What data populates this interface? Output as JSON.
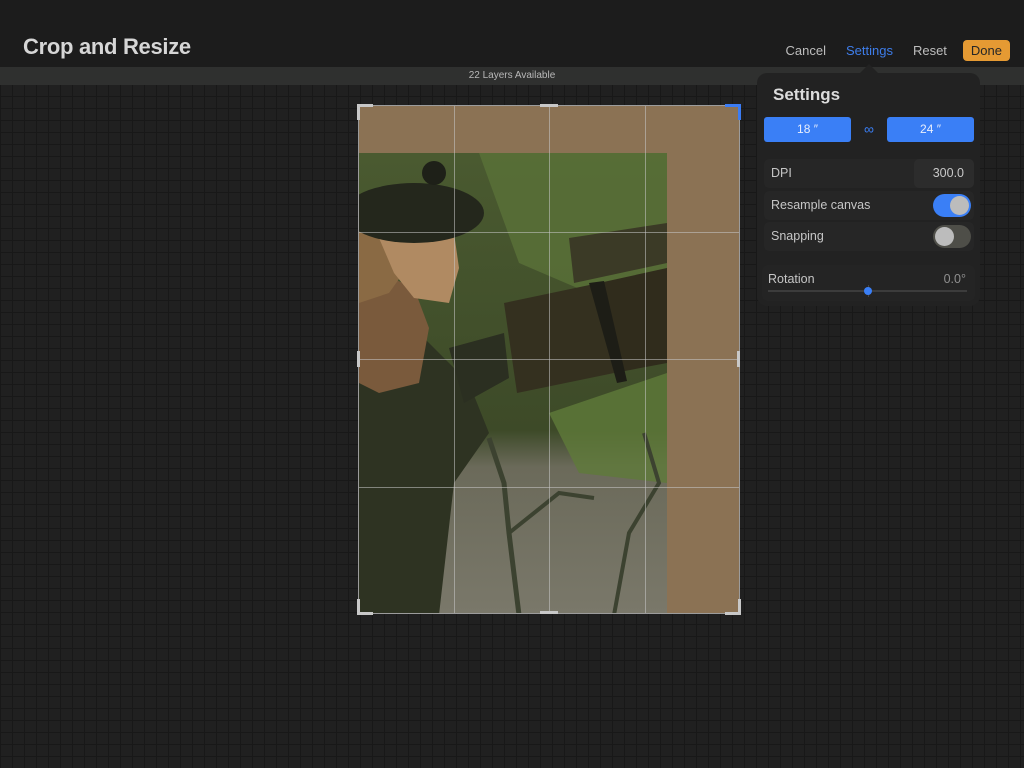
{
  "header": {
    "title": "Crop and Resize",
    "actions": {
      "cancel": "Cancel",
      "settings": "Settings",
      "reset": "Reset",
      "done": "Done"
    }
  },
  "layers_status": "22 Layers Available",
  "settings_panel": {
    "title": "Settings",
    "width": "18 ″",
    "height": "24 ″",
    "link_icon": "link-icon",
    "dpi_label": "DPI",
    "dpi_value": "300.0",
    "resample_label": "Resample canvas",
    "resample_on": true,
    "snapping_label": "Snapping",
    "snapping_on": false,
    "rotation_label": "Rotation",
    "rotation_value": "0.0°",
    "rotation_slider_fraction": 0.5
  },
  "colors": {
    "accent": "#3a7ff6",
    "done_button": "#e59a33",
    "canvas_fill": "#8b7254",
    "selected_corner": "#3b7cf3"
  },
  "crop_grid": "rule-of-thirds"
}
